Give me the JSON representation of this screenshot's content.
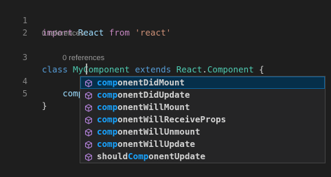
{
  "lines": [
    {
      "num": "1",
      "tokens": [
        {
          "t": "import",
          "c": "kw2"
        },
        {
          "t": " React ",
          "c": "var"
        },
        {
          "t": "from",
          "c": "kw2"
        },
        {
          "t": " ",
          "c": "plain"
        },
        {
          "t": "'react'",
          "c": "str"
        }
      ]
    },
    {
      "num": "2",
      "tokens": []
    },
    {
      "num": "3",
      "tokens": [
        {
          "t": "class",
          "c": "kw"
        },
        {
          "t": " ",
          "c": "plain"
        },
        {
          "t": "MyComponent",
          "c": "cls"
        },
        {
          "t": " ",
          "c": "plain"
        },
        {
          "t": "extends",
          "c": "kw"
        },
        {
          "t": " ",
          "c": "plain"
        },
        {
          "t": "React",
          "c": "cls"
        },
        {
          "t": ".",
          "c": "plain"
        },
        {
          "t": "Component",
          "c": "cls"
        },
        {
          "t": " {",
          "c": "plain"
        }
      ]
    },
    {
      "num": "4",
      "tokens": [
        {
          "t": "    comp ",
          "c": "var"
        }
      ]
    },
    {
      "num": "5",
      "tokens": [
        {
          "t": "}",
          "c": "plain"
        }
      ]
    }
  ],
  "codelens": {
    "class_refs": "0 references",
    "method_refs": "0 references"
  },
  "suggestions": [
    {
      "prefix": "comp",
      "rest": "onentDidMount",
      "pre": "",
      "selected": true
    },
    {
      "prefix": "comp",
      "rest": "onentDidUpdate",
      "pre": "",
      "selected": false
    },
    {
      "prefix": "comp",
      "rest": "onentWillMount",
      "pre": "",
      "selected": false
    },
    {
      "prefix": "comp",
      "rest": "onentWillReceiveProps",
      "pre": "",
      "selected": false
    },
    {
      "prefix": "comp",
      "rest": "onentWillUnmount",
      "pre": "",
      "selected": false
    },
    {
      "prefix": "comp",
      "rest": "onentWillUpdate",
      "pre": "",
      "selected": false
    },
    {
      "prefix": "Comp",
      "rest": "onentUpdate",
      "pre": "should",
      "selected": false
    }
  ],
  "suggestion_icon": "method-cube-icon",
  "colors": {
    "background": "#1e1e1e",
    "highlight": "#18a3ff",
    "icon": "#b180d7"
  }
}
